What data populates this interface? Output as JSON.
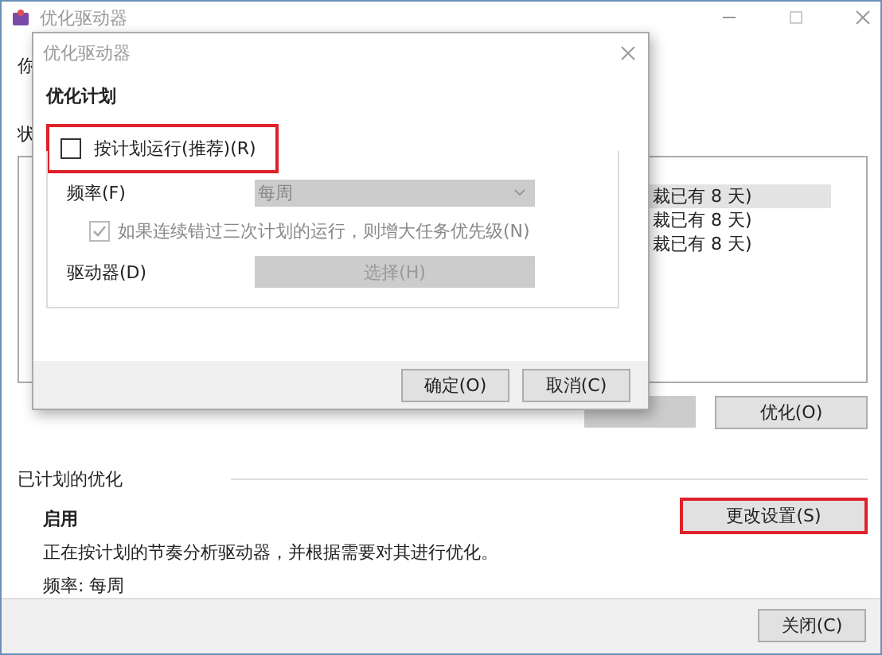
{
  "window": {
    "title": "优化驱动器",
    "intro_cut": "你",
    "status_cut": "状"
  },
  "drive_rows": [
    {
      "status": "裁已有 8 天)",
      "selected": true
    },
    {
      "status": "裁已有 8 天)",
      "selected": false
    },
    {
      "status": "裁已有 8 天)",
      "selected": false
    }
  ],
  "optimize_button": {
    "label": "优化(O)"
  },
  "scheduled": {
    "heading": "已计划的优化",
    "state": "启用",
    "description": "正在按计划的节奏分析驱动器，并根据需要对其进行优化。",
    "frequency": "频率: 每周",
    "change_button": {
      "label": "更改设置(S)",
      "highlighted": true
    }
  },
  "close_button": {
    "label": "关闭(C)"
  },
  "dialog": {
    "title": "优化驱动器",
    "heading": "优化计划",
    "run_on_schedule": {
      "label": "按计划运行(推荐)(R)",
      "checked": false,
      "highlighted": true
    },
    "frequency_label": "频率(F)",
    "frequency_value": "每周",
    "frequency_disabled": true,
    "increase_priority": {
      "label": "如果连续错过三次计划的运行，则增大任务优先级(N)",
      "checked": true,
      "disabled": true
    },
    "drives_label": "驱动器(D)",
    "choose_button": {
      "label": "选择(H)",
      "disabled": true
    },
    "buttons": [
      {
        "label": "确定(O)"
      },
      {
        "label": "取消(C)"
      }
    ]
  }
}
